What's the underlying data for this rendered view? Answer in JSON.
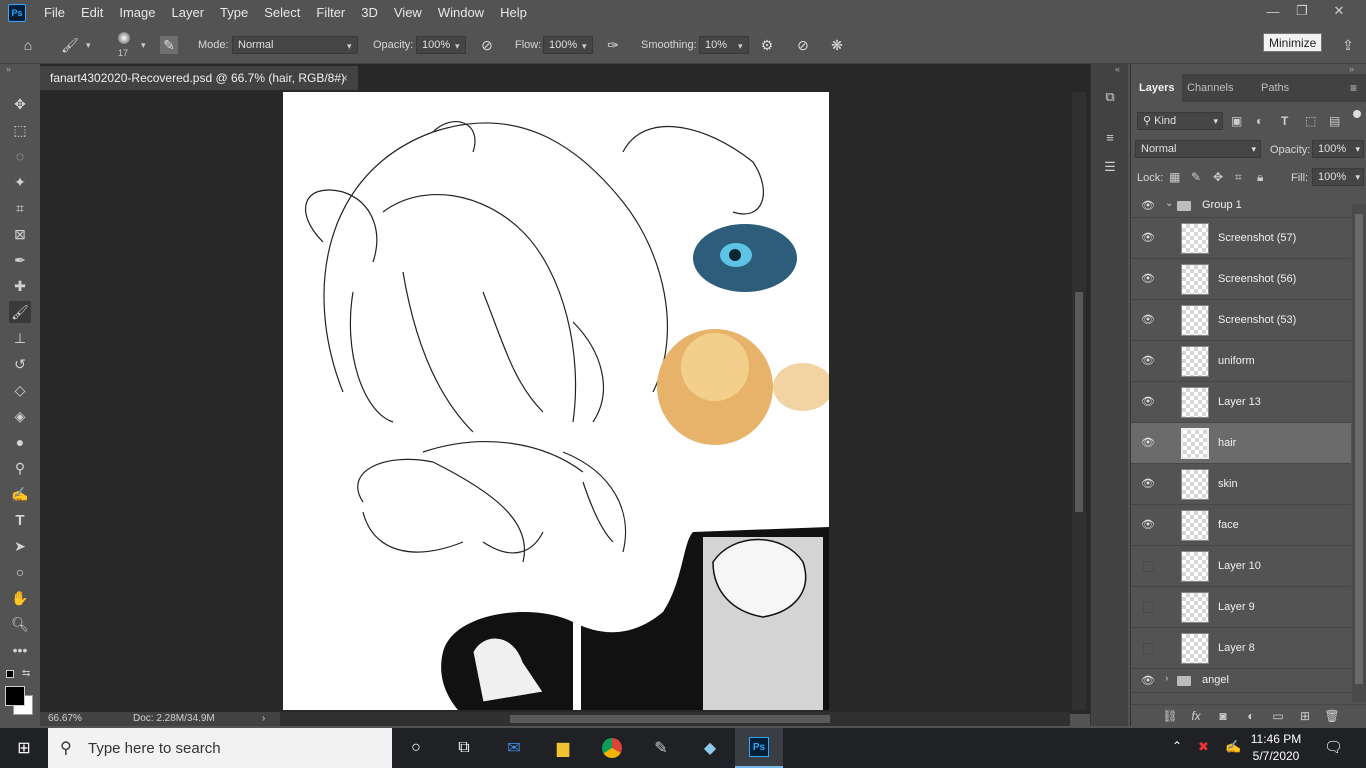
{
  "app": {
    "logo": "Ps"
  },
  "menu": [
    "File",
    "Edit",
    "Image",
    "Layer",
    "Type",
    "Select",
    "Filter",
    "3D",
    "View",
    "Window",
    "Help"
  ],
  "window_controls": {
    "minimize": "—",
    "restore": "❐",
    "close": "✕"
  },
  "tooltip": "Minimize",
  "options_bar": {
    "brush_size": "17",
    "mode_label": "Mode:",
    "mode_value": "Normal",
    "opacity_label": "Opacity:",
    "opacity_value": "100%",
    "flow_label": "Flow:",
    "flow_value": "100%",
    "smoothing_label": "Smoothing:",
    "smoothing_value": "10%"
  },
  "document": {
    "tab_title": "fanart4302020-Recovered.psd @ 66.7% (hair, RGB/8#)",
    "tab_close": "×",
    "zoom": "66.67%",
    "doc_info": "Doc: 2.28M/34.9M"
  },
  "layers_panel": {
    "tabs": [
      "Layers",
      "Channels",
      "Paths"
    ],
    "filter_kind": "Kind",
    "blend_mode": "Normal",
    "opacity_label": "Opacity:",
    "opacity_value": "100%",
    "lock_label": "Lock:",
    "fill_label": "Fill:",
    "fill_value": "100%",
    "group_open": "Group 1",
    "layers": [
      {
        "name": "Screenshot (57)",
        "visible": true
      },
      {
        "name": "Screenshot (56)",
        "visible": true
      },
      {
        "name": "Screenshot (53)",
        "visible": true
      },
      {
        "name": "uniform",
        "visible": true
      },
      {
        "name": "Layer 13",
        "visible": true
      },
      {
        "name": "hair",
        "visible": true,
        "selected": true
      },
      {
        "name": "skin",
        "visible": true
      },
      {
        "name": "face",
        "visible": true
      },
      {
        "name": "Layer 10",
        "visible": false
      },
      {
        "name": "Layer 9",
        "visible": false
      },
      {
        "name": "Layer 8",
        "visible": false
      }
    ],
    "group_closed": "angel"
  },
  "taskbar": {
    "search_placeholder": "Type here to search",
    "time": "11:46 PM",
    "date": "5/7/2020"
  },
  "colors": {
    "accent": "#31a8ff",
    "canvas_bg": "#282828",
    "panel_bg": "#535353"
  }
}
